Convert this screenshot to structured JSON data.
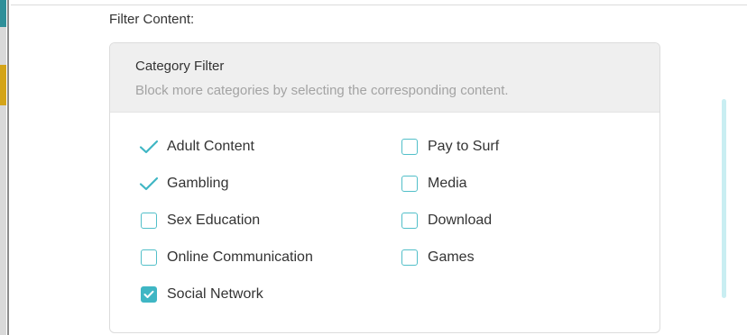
{
  "filter_content": {
    "label": "Filter Content:"
  },
  "category_filter": {
    "title": "Category Filter",
    "description": "Block more categories by selecting the corresponding content.",
    "left_column": [
      {
        "label": "Adult Content",
        "state": "checked",
        "indicator": "checkmark"
      },
      {
        "label": "Gambling",
        "state": "checked",
        "indicator": "checkmark"
      },
      {
        "label": "Sex Education",
        "state": "unchecked",
        "indicator": "checkbox"
      },
      {
        "label": "Online Communication",
        "state": "unchecked",
        "indicator": "checkbox"
      },
      {
        "label": "Social Network",
        "state": "checked",
        "indicator": "checkbox"
      }
    ],
    "right_column": [
      {
        "label": "Pay to Surf",
        "state": "unchecked",
        "indicator": "checkbox"
      },
      {
        "label": "Media",
        "state": "unchecked",
        "indicator": "checkbox"
      },
      {
        "label": "Download",
        "state": "unchecked",
        "indicator": "checkbox"
      },
      {
        "label": "Games",
        "state": "unchecked",
        "indicator": "checkbox"
      }
    ]
  },
  "colors": {
    "accent": "#3fb6c4",
    "checkbox_border": "#52bfc9",
    "text": "#333333",
    "muted_text": "#a3a3a3",
    "header_bg": "#efefef"
  }
}
